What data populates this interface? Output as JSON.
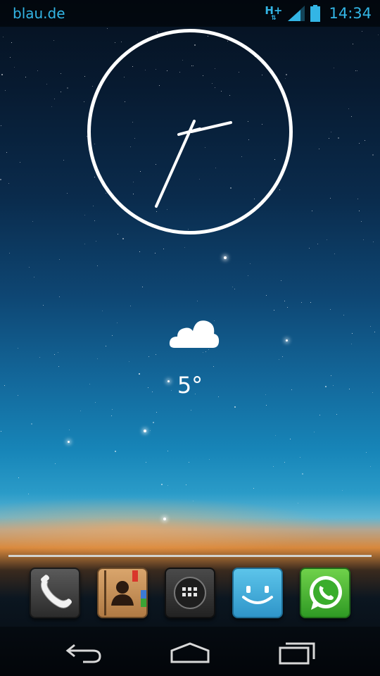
{
  "status_bar": {
    "carrier": "blau.de",
    "network_type": "H+",
    "network_arrows": "⇅",
    "signal_icon": "signal-bars-icon",
    "battery_icon": "battery-icon",
    "time": "14:34",
    "accent_color": "#33b5e5"
  },
  "clock_widget": {
    "style": "analog",
    "hour_icon": "clock-hour-hand"
  },
  "weather_widget": {
    "icon": "cloud-icon",
    "temperature": "5°"
  },
  "dock": {
    "apps": [
      {
        "icon": "phone-icon"
      },
      {
        "icon": "contacts-icon"
      },
      {
        "icon": "app-drawer-icon"
      },
      {
        "icon": "messaging-icon"
      },
      {
        "icon": "whatsapp-icon"
      }
    ]
  },
  "nav_bar": {
    "back_icon": "back-icon",
    "home_icon": "home-icon",
    "recents_icon": "recents-icon"
  }
}
